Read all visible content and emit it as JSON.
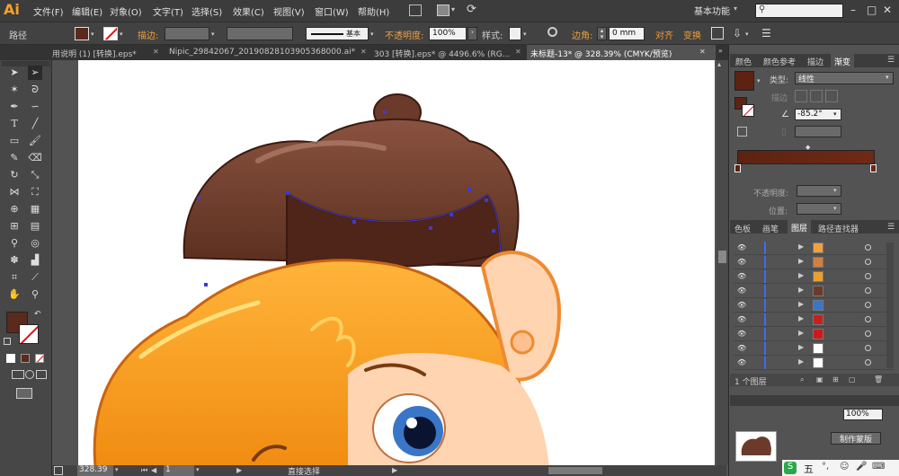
{
  "app": {
    "logo": "Ai",
    "workspace": "基本功能",
    "search_icon": "search-icon"
  },
  "menus": [
    "文件(F)",
    "编辑(E)",
    "对象(O)",
    "文字(T)",
    "选择(S)",
    "效果(C)",
    "视图(V)",
    "窗口(W)",
    "帮助(H)"
  ],
  "control": {
    "object_type": "路径",
    "stroke_label": "描边:",
    "brush_value": "基本",
    "opacity_label": "不透明度:",
    "opacity_value": "100%",
    "style_label": "样式:",
    "corner_label": "边角:",
    "corner_value": "0 mm",
    "align_label": "对齐",
    "transform_label": "变换",
    "fill_color": "#5a2a1c"
  },
  "tabs": [
    "用说明 (1) [转换].eps*",
    "Nipic_29842067_20190828103905368000.ai*",
    "303 [转换].eps* @ 4496.6% (RG...",
    "未标题-13* @ 328.39% (CMYK/预览)"
  ],
  "status": {
    "zoom": "328.39",
    "page": "1",
    "tool": "直接选择"
  },
  "gradient_panel": {
    "tabs": [
      "颜色",
      "颜色参考",
      "描边",
      "渐变"
    ],
    "type_label": "类型:",
    "type_value": "线性",
    "stroke_label": "描边",
    "angle_value": "-85.2°",
    "opacity_label": "不透明度:",
    "position_label": "位置:",
    "color_start": "#5c2312",
    "color_end": "#6f2a14"
  },
  "layers_panel": {
    "tabs": [
      "色板",
      "画笔",
      "图层",
      "路径查找器"
    ],
    "count_label": "1 个图层"
  },
  "lower_panel": {
    "opacity_value": "100%",
    "button": "制作蒙版"
  },
  "taskbar": {
    "ime": "五"
  }
}
